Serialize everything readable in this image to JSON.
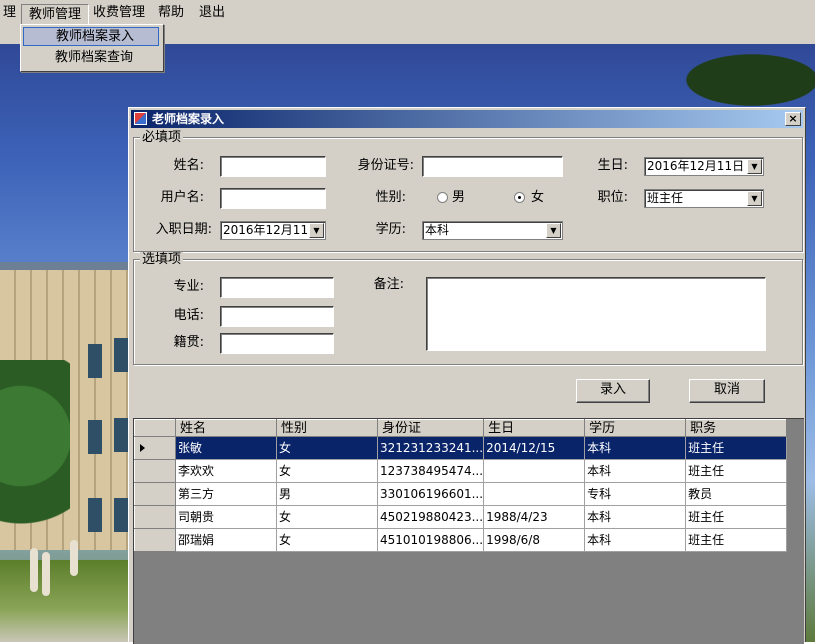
{
  "menu": {
    "items": [
      "理",
      "教师管理",
      "收费管理",
      "帮助",
      "退出"
    ],
    "dropdown": [
      "教师档案录入",
      "教师档案查询"
    ]
  },
  "dialog": {
    "title": "老师档案录入",
    "close_glyph": "×",
    "required": {
      "legend": "必填项",
      "name_label": "姓名:",
      "id_label": "身份证号:",
      "birth_label": "生日:",
      "birth_value": "2016年12月11日",
      "username_label": "用户名:",
      "gender_label": "性别:",
      "gender_male": "男",
      "gender_female": "女",
      "gender_selected": "女",
      "position_label": "职位:",
      "position_value": "班主任",
      "hire_label": "入职日期:",
      "hire_value": "2016年12月11日",
      "edu_label": "学历:",
      "edu_value": "本科"
    },
    "optional": {
      "legend": "选填项",
      "major_label": "专业:",
      "phone_label": "电话:",
      "origin_label": "籍贯:",
      "note_label": "备注:"
    },
    "buttons": {
      "submit": "录入",
      "cancel": "取消"
    },
    "grid": {
      "columns": [
        "姓名",
        "性别",
        "身份证",
        "生日",
        "学历",
        "职务"
      ],
      "rows": [
        [
          "张敏",
          "女",
          "321231233241...",
          "2014/12/15",
          "本科",
          "班主任"
        ],
        [
          "李欢欢",
          "女",
          "123738495474...",
          "",
          "本科",
          "班主任"
        ],
        [
          "第三方",
          "男",
          "330106196601...",
          "",
          "专科",
          "教员"
        ],
        [
          "司朝贵",
          "女",
          "450219880423...",
          "1988/4/23",
          "本科",
          "班主任"
        ],
        [
          "邵瑞娟",
          "女",
          "451010198806...",
          "1998/6/8",
          "本科",
          "班主任"
        ]
      ]
    }
  },
  "colors": {
    "face": "#d4d0c8",
    "title_start": "#0a246a",
    "title_end": "#a6caf0",
    "selection": "#0a246a"
  }
}
